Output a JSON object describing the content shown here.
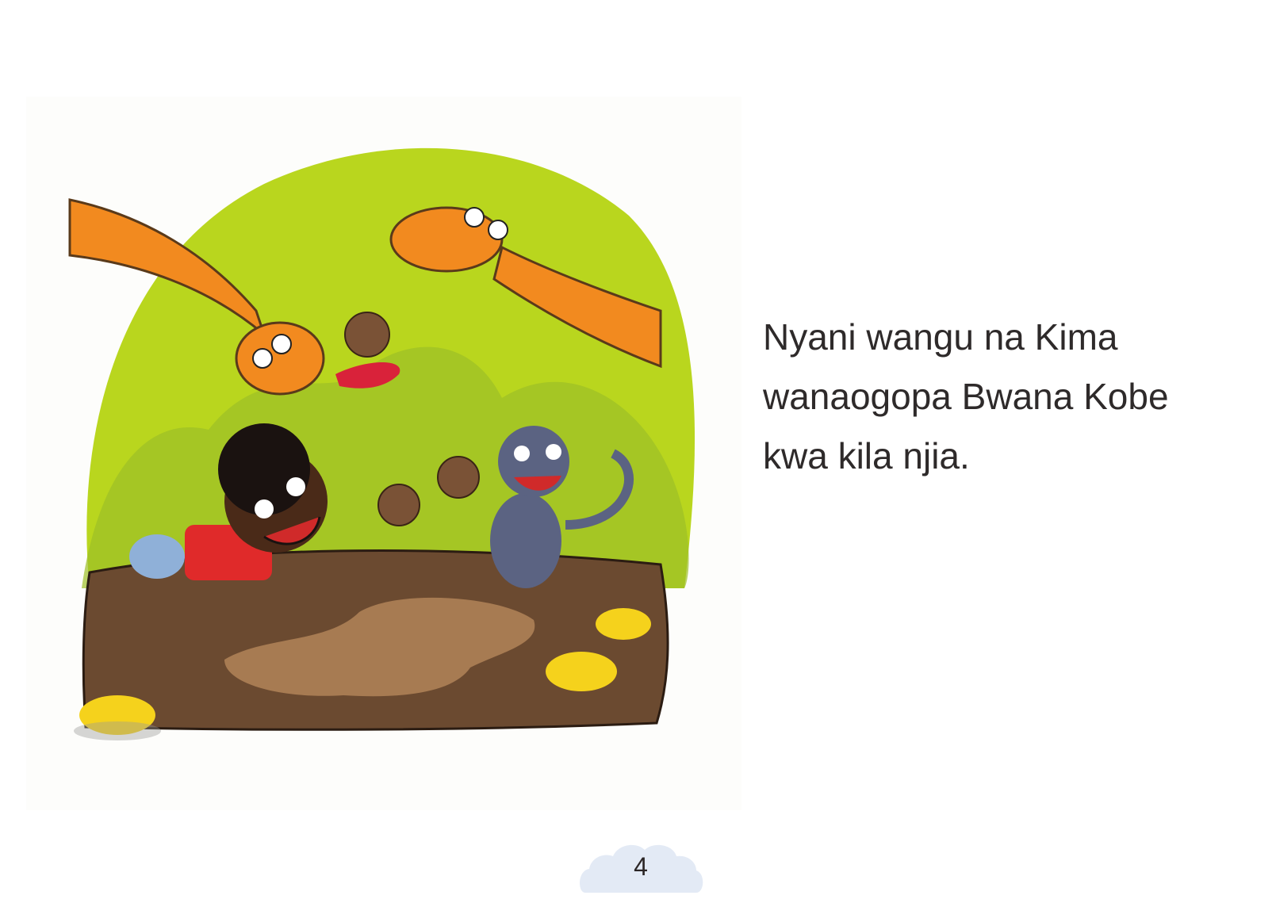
{
  "story": {
    "lines": [
      "Nyani wangu na Kima",
      "wanaogopa Bwana Kobe",
      "kwa kila njia."
    ]
  },
  "page_number": "4",
  "colors": {
    "background_green": "#b9d61e",
    "ground_brown": "#6b4a30",
    "giraffe_orange": "#f28a1f",
    "cloud": "#e3eaf5",
    "text": "#2e2a2a"
  }
}
